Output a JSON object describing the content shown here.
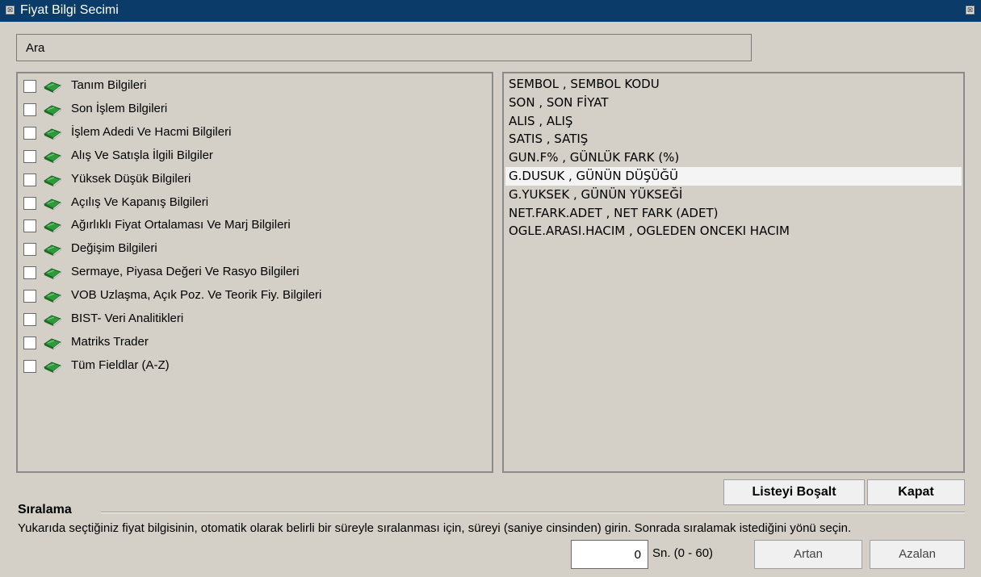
{
  "window": {
    "title": "Fiyat Bilgi Secimi",
    "icon_left": "close-box-icon",
    "icon_right": "close-box-icon"
  },
  "search": {
    "placeholder": "Ara",
    "value": ""
  },
  "categories": [
    {
      "label": "Tanım Bilgileri",
      "checked": false
    },
    {
      "label": "Son İşlem Bilgileri",
      "checked": false
    },
    {
      "label": "İşlem Adedi Ve Hacmi Bilgileri",
      "checked": false
    },
    {
      "label": "Alış Ve Satışla İlgili Bilgiler",
      "checked": false
    },
    {
      "label": "Yüksek Düşük Bilgileri",
      "checked": false
    },
    {
      "label": "Açılış Ve Kapanış Bilgileri",
      "checked": false
    },
    {
      "label": "Ağırlıklı Fiyat Ortalaması Ve Marj Bilgileri",
      "checked": false
    },
    {
      "label": "Değişim Bilgileri",
      "checked": false
    },
    {
      "label": "Sermaye, Piyasa Değeri Ve Rasyo Bilgileri",
      "checked": false
    },
    {
      "label": "VOB Uzlaşma, Açık Poz. Ve Teorik Fiy. Bilgileri",
      "checked": false
    },
    {
      "label": "BIST- Veri Analitikleri",
      "checked": false
    },
    {
      "label": "Matriks Trader",
      "checked": false
    },
    {
      "label": "Tüm Fieldlar (A-Z)",
      "checked": false
    }
  ],
  "selected_fields": [
    {
      "label": "SEMBOL , SEMBOL KODU",
      "selected": false
    },
    {
      "label": "SON , SON FİYAT",
      "selected": false
    },
    {
      "label": "ALIS , ALIŞ",
      "selected": false
    },
    {
      "label": "SATIS , SATIŞ",
      "selected": false
    },
    {
      "label": "GUN.F% , GÜNLÜK FARK (%)",
      "selected": false
    },
    {
      "label": "G.DUSUK , GÜNÜN DÜŞÜĞÜ",
      "selected": true
    },
    {
      "label": "G.YUKSEK , GÜNÜN YÜKSEĞİ",
      "selected": false
    },
    {
      "label": "NET.FARK.ADET , NET FARK (ADET)",
      "selected": false
    },
    {
      "label": "OGLE.ARASI.HACIM , OGLEDEN ONCEKI HACIM",
      "selected": false
    }
  ],
  "buttons": {
    "clear_list": "Listeyi Boşalt",
    "close": "Kapat",
    "ascending": "Artan",
    "descending": "Azalan"
  },
  "sorting": {
    "title": "Sıralama",
    "description": "Yukarıda seçtiğiniz fiyat bilgisinin, otomatik olarak belirli bir süreyle sıralanması için, süreyi (saniye cinsinden) girin. Sonrada sıralamak istediğini yönü seçin.",
    "seconds_value": "0",
    "unit_label": "Sn. (0 - 60)"
  },
  "colors": {
    "titlebar": "#0a3b69",
    "window_bg": "#d4d0c8",
    "book_icon": "#2e9a3a"
  }
}
